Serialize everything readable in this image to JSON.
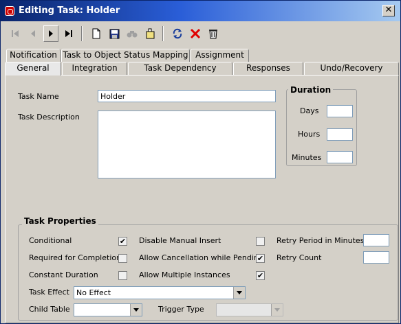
{
  "window": {
    "title": "Editing Task: Holder"
  },
  "toolbar": {
    "icons": [
      "first-record-icon",
      "previous-record-icon",
      "next-record-icon",
      "last-record-icon",
      "new-icon",
      "save-icon",
      "find-icon",
      "copy-icon",
      "refresh-icon",
      "delete-icon",
      "trash-icon"
    ]
  },
  "tabs": {
    "row1": [
      "Notification",
      "Task to Object Status Mapping",
      "Assignment"
    ],
    "row2": [
      "General",
      "Integration",
      "Task Dependency",
      "Responses",
      "Undo/Recovery"
    ],
    "active": "General"
  },
  "general": {
    "task_name_label": "Task Name",
    "task_name_value": "Holder",
    "task_description_label": "Task Description",
    "task_description_value": "",
    "duration": {
      "title": "Duration",
      "days_label": "Days",
      "hours_label": "Hours",
      "minutes_label": "Minutes",
      "days_value": "",
      "hours_value": "",
      "minutes_value": ""
    },
    "properties": {
      "title": "Task Properties",
      "conditional_label": "Conditional",
      "conditional_checked": "✔",
      "required_label": "Required for Completion",
      "required_checked": "",
      "constant_label": "Constant Duration",
      "constant_checked": "",
      "disable_manual_label": "Disable Manual Insert",
      "disable_manual_checked": "",
      "allow_cancel_label": "Allow Cancellation while Pending",
      "allow_cancel_checked": "✔",
      "allow_multiple_label": "Allow Multiple Instances",
      "allow_multiple_checked": "✔",
      "retry_period_label": "Retry Period in Minutes",
      "retry_period_value": "",
      "retry_count_label": "Retry Count",
      "retry_count_value": "",
      "task_effect_label": "Task Effect",
      "task_effect_value": "No Effect",
      "child_table_label": "Child Table",
      "child_table_value": "",
      "trigger_type_label": "Trigger Type",
      "trigger_type_value": ""
    }
  }
}
